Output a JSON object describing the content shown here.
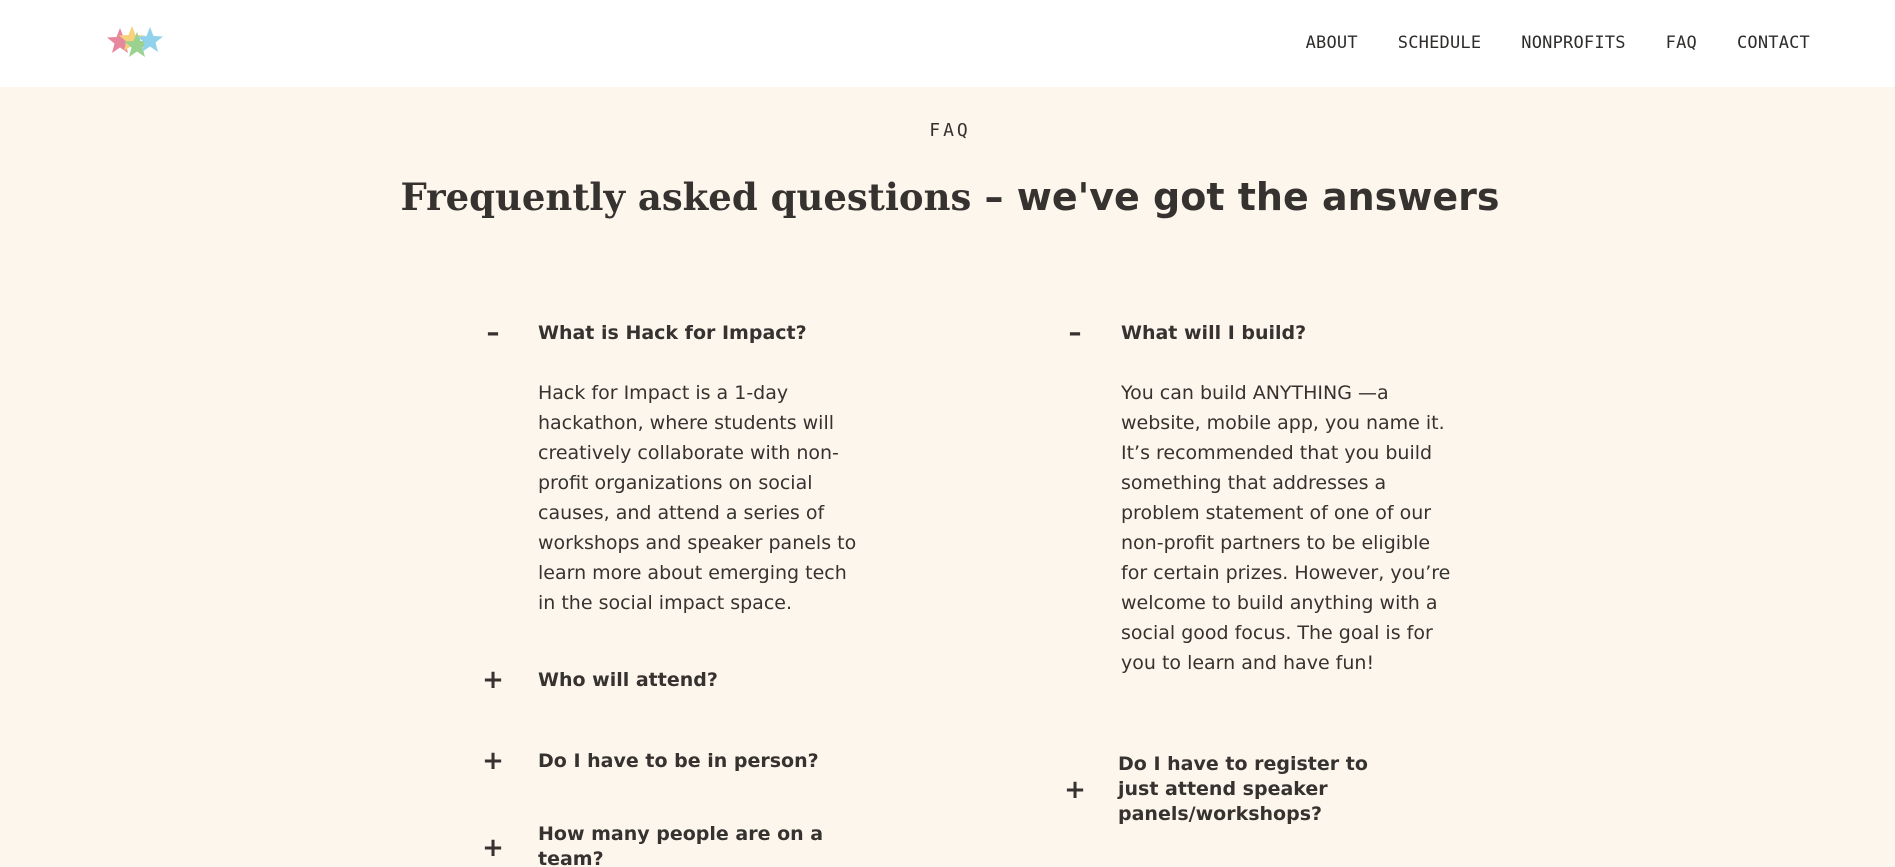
{
  "nav": {
    "logo_icon": "stars-logo-icon",
    "items": [
      "ABOUT",
      "SCHEDULE",
      "NONPROFITS",
      "FAQ",
      "CONTACT"
    ]
  },
  "section": {
    "eyebrow": "FAQ",
    "title_bold": "Frequently asked questions",
    "title_rest": " – we've got the answers"
  },
  "faq": {
    "left": [
      {
        "toggle": "–",
        "question": "What is Hack for Impact?",
        "answer": "Hack for Impact is a 1-day hackathon, where students will creatively collaborate with non-profit organizations on social causes, and attend a series of workshops and speaker panels to learn more about emerging tech in the social impact space."
      },
      {
        "toggle": "+",
        "question": "Who will attend?"
      },
      {
        "toggle": "+",
        "question": "Do I have to be in person?"
      },
      {
        "toggle": "+",
        "question": "How many people are on a team?"
      }
    ],
    "right": [
      {
        "toggle": "–",
        "question": "What will I build?",
        "answer": "You can build ANYTHING —a website, mobile app, you name it. It’s recommended that you build something that addresses a problem statement of one of our non-profit partners to be eligible for certain prizes. However, you’re welcome to build anything with a social good focus. The goal is for you to learn and have fun!"
      },
      {
        "toggle": "+",
        "question": "Do I have to register to just attend speaker panels/workshops?"
      }
    ]
  },
  "colors": {
    "background": "#fdf6ec",
    "header": "#ffffff",
    "text": "#353230",
    "logo_pink": "#e0607e",
    "logo_yellow": "#f2c34f",
    "logo_blue": "#6cc3e6"
  }
}
